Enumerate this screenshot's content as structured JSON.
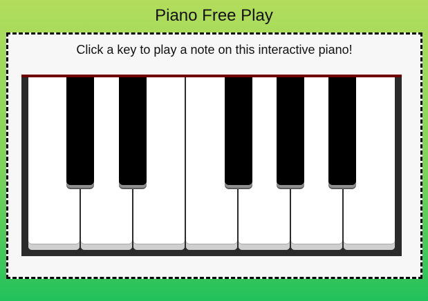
{
  "header": {
    "title": "Piano Free Play"
  },
  "panel": {
    "instructions": "Click a key to play a note on this interactive piano!"
  },
  "piano": {
    "white_key_count": 7,
    "black_key_count": 5,
    "colors": {
      "frame": "#2b2b2b",
      "top_rail": "#6e0000",
      "white_key": "#ffffff",
      "black_key": "#000000"
    }
  },
  "theme": {
    "background_top": "#b3dd5c",
    "background_bottom": "#22c15b",
    "panel_background": "#f7f7f7",
    "panel_border": "#000000"
  }
}
